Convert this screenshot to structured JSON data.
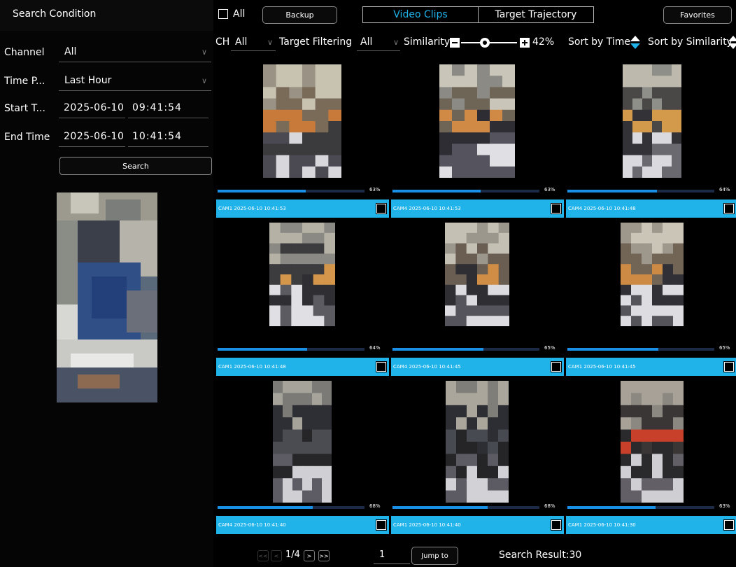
{
  "left": {
    "title": "Search Condition",
    "channel_label": "Channel",
    "channel_value": "All",
    "time_period_label": "Time P...",
    "time_period_value": "Last Hour",
    "start_label": "Start T...",
    "start_date": "2025-06-10",
    "start_time": "09:41:54",
    "end_label": "End Time",
    "end_date": "2025-06-10",
    "end_time": "10:41:54",
    "search_button": "Search"
  },
  "toolbar": {
    "all_label": "All",
    "backup_label": "Backup",
    "tab_video_clips": "Video Clips",
    "tab_target_trajectory": "Target Trajectory",
    "favorites_label": "Favorites",
    "ch_label": "CH",
    "ch_value": "All",
    "target_filtering_label": "Target Filtering",
    "target_filtering_value": "All",
    "similarity_label": "Similarity",
    "similarity_value": "42%",
    "similarity_fraction": 0.42,
    "sort_time_label": "Sort by Time",
    "sort_similarity_label": "Sort by Similarity"
  },
  "results": [
    {
      "pct": "63%",
      "fill": 0.63,
      "caption": "CAM1 2025-06-10 10:41:53"
    },
    {
      "pct": "63%",
      "fill": 0.63,
      "caption": "CAM4 2025-06-10 10:41:53"
    },
    {
      "pct": "64%",
      "fill": 0.64,
      "caption": "CAM4 2025-06-10 10:41:48"
    },
    {
      "pct": "64%",
      "fill": 0.64,
      "caption": "CAM1 2025-06-10 10:41:48"
    },
    {
      "pct": "65%",
      "fill": 0.65,
      "caption": "CAM4 2025-06-10 10:41:45"
    },
    {
      "pct": "65%",
      "fill": 0.65,
      "caption": "CAM1 2025-06-10 10:41:45"
    },
    {
      "pct": "68%",
      "fill": 0.68,
      "caption": "CAM4 2025-06-10 10:41:40"
    },
    {
      "pct": "68%",
      "fill": 0.68,
      "caption": "CAM1 2025-06-10 10:41:40"
    },
    {
      "pct": "63%",
      "fill": 0.63,
      "caption": "CAM1 2025-06-10 10:41:30"
    }
  ],
  "pagination": {
    "first": "<<",
    "prev": "<",
    "page": "1/4",
    "next": ">",
    "last": ">>",
    "jump_value": "1",
    "jump_button": "Jump to",
    "result_text": "Search Result:30"
  },
  "colors": {
    "accent": "#1fb3ea",
    "progress": "#1a8fe6",
    "tab_active_text": "#1fb3ea"
  }
}
